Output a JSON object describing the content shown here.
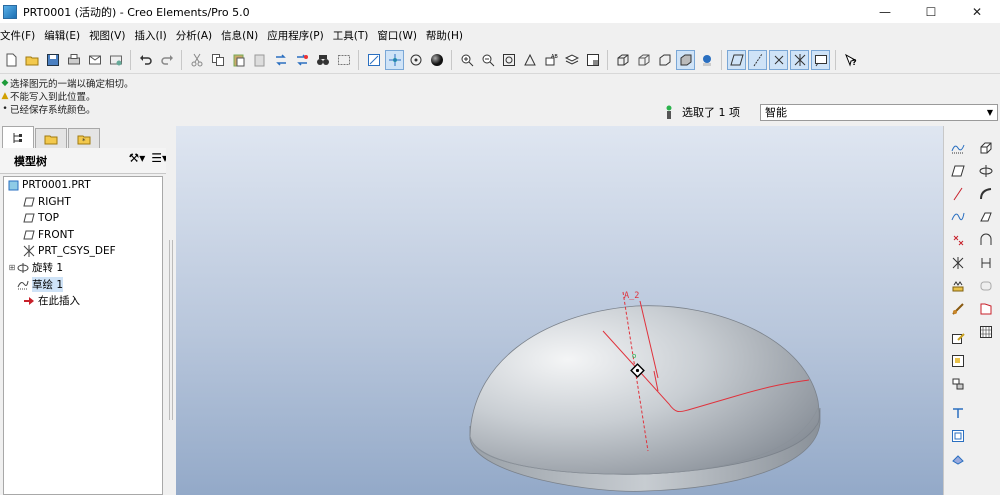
{
  "window": {
    "title": "PRT0001 (活动的) - Creo Elements/Pro 5.0",
    "controls": [
      "—",
      "☐",
      "✕"
    ]
  },
  "menu": [
    "文件(F)",
    "编辑(E)",
    "视图(V)",
    "插入(I)",
    "分析(A)",
    "信息(N)",
    "应用程序(P)",
    "工具(T)",
    "窗口(W)",
    "帮助(H)"
  ],
  "messages": [
    {
      "type": "ok",
      "text": "选择图元的一端以确定相切。"
    },
    {
      "type": "warn",
      "text": "不能写入到此位置。"
    },
    {
      "type": "info",
      "text": "已经保存系统颜色。"
    }
  ],
  "selection": {
    "status": "选取了 1 项",
    "filter": "智能"
  },
  "model_tree": {
    "header": "模型树",
    "items": [
      {
        "label": "PRT0001.PRT",
        "icon": "part-icon"
      },
      {
        "label": "RIGHT",
        "icon": "datum-plane-icon"
      },
      {
        "label": "TOP",
        "icon": "datum-plane-icon"
      },
      {
        "label": "FRONT",
        "icon": "datum-plane-icon"
      },
      {
        "label": "PRT_CSYS_DEF",
        "icon": "csys-icon"
      },
      {
        "label": "旋转 1",
        "icon": "revolve-icon"
      },
      {
        "label": "草绘 1",
        "icon": "sketch-icon"
      },
      {
        "label": "在此插入",
        "icon": "insert-here-icon"
      }
    ]
  },
  "viewport": {
    "axis_label": "A_2",
    "colors": {
      "sketch": "#e0323c",
      "axis": "#e0323c",
      "highlight": "#22b14c",
      "body_light": "#eef0f2",
      "body_dark": "#8d949c"
    }
  }
}
